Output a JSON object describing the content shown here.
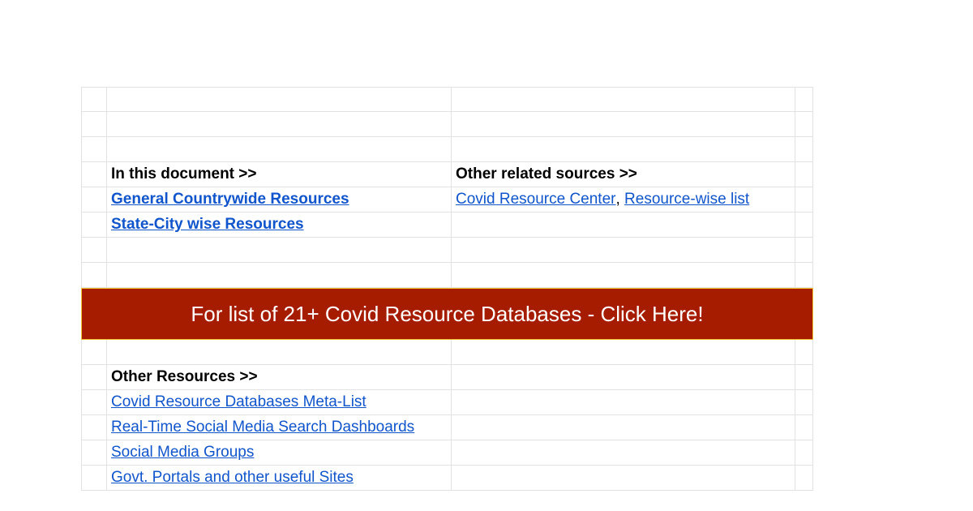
{
  "top_section": {
    "in_this_document_header": "In this document >>",
    "other_related_header": "Other related sources >>",
    "general_countrywide": "General Countrywide Resources",
    "state_city_wise": "State-City wise Resources",
    "covid_resource_center": "Covid Resource Center",
    "separator": ",",
    "resource_wise_list": "Resource-wise list"
  },
  "banner": {
    "text": "For list of 21+ Covid Resource Databases - Click Here!",
    "background_color": "#a61c00",
    "border_color": "#f1c232"
  },
  "other_resources": {
    "header": "Other Resources >>",
    "links": [
      "Covid Resource Databases Meta-List",
      "Real-Time Social Media Search Dashboards",
      "Social Media Groups",
      "Govt. Portals and other useful Sites"
    ]
  },
  "colors": {
    "link": "#1155cc",
    "grid": "#e2e2e2"
  }
}
